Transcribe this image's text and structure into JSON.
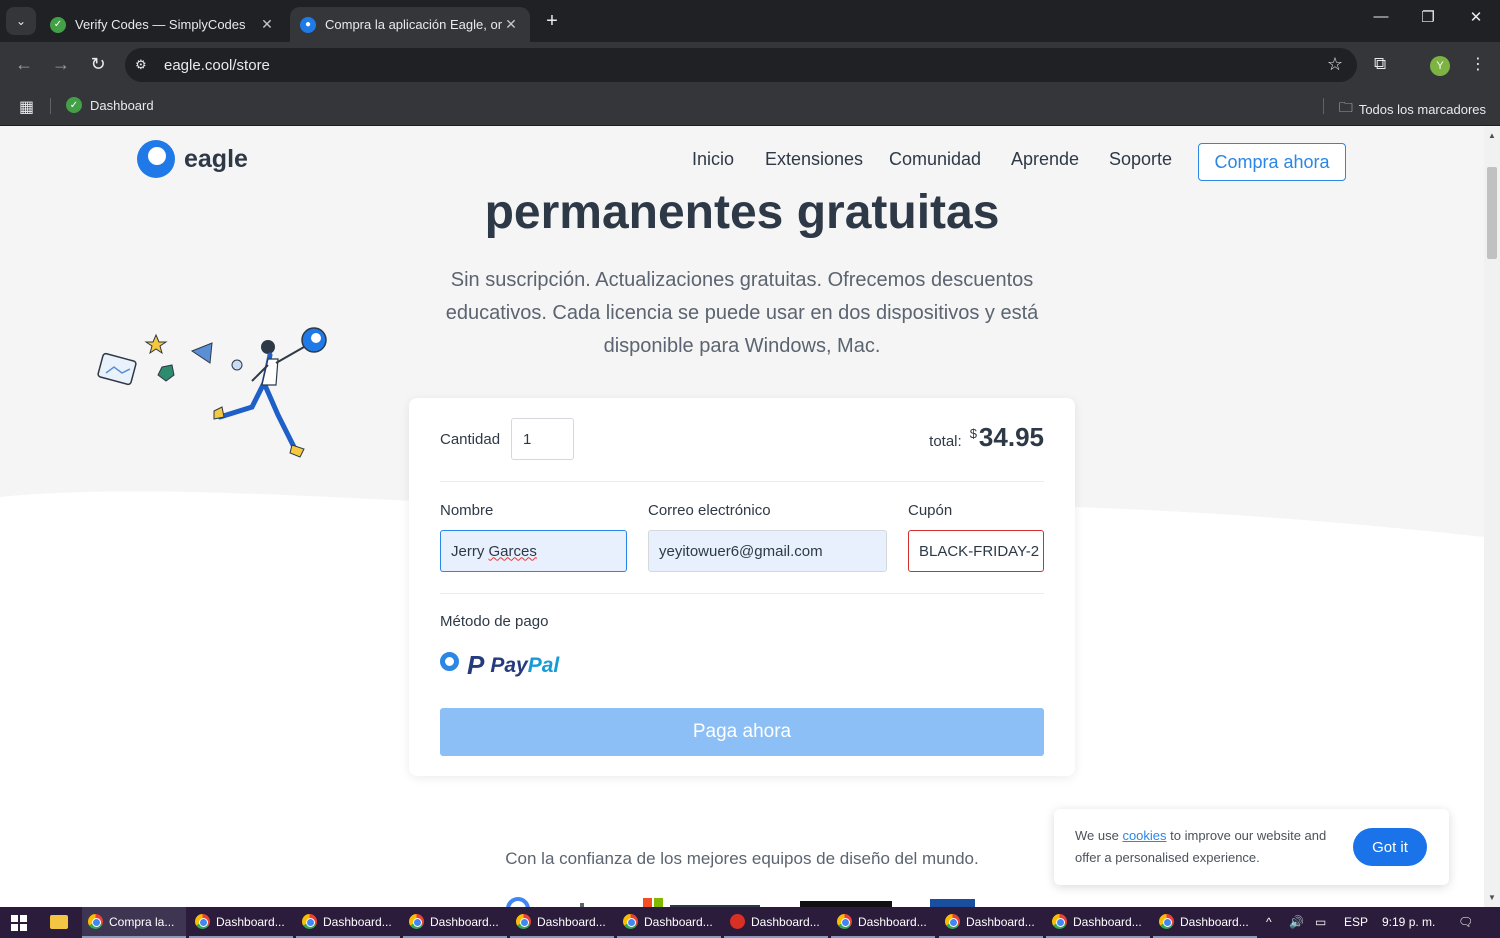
{
  "browser": {
    "tabs": [
      {
        "title": "Verify Codes — SimplyCodes",
        "active": false
      },
      {
        "title": "Compra la aplicación Eagle, org",
        "active": true
      }
    ],
    "url": "eagle.cool/store",
    "profile_initial": "Y",
    "bookmarks": [
      {
        "label": "Dashboard"
      }
    ],
    "all_bookmarks_label": "Todos los marcadores"
  },
  "site": {
    "logo_text": "eagle",
    "nav": [
      "Inicio",
      "Extensiones",
      "Comunidad",
      "Aprende",
      "Soporte"
    ],
    "cta": "Compra ahora"
  },
  "hero": {
    "headline": "permanentes gratuitas",
    "subtext": "Sin suscripción. Actualizaciones gratuitas. Ofrecemos descuentos educativos. Cada licencia se puede usar en dos dispositivos y está disponible para Windows, Mac."
  },
  "checkout": {
    "quantity_label": "Cantidad",
    "quantity_value": "1",
    "total_label": "total:",
    "currency": "$",
    "total_amount": "34.95",
    "name_label": "Nombre",
    "name_first": "Jerry ",
    "name_last": "Garces",
    "email_label": "Correo electrónico",
    "email_value": "yeyitowuer6@gmail.com",
    "coupon_label": "Cupón",
    "coupon_value": "BLACK-FRIDAY-2",
    "payment_label": "Método de pago",
    "paypal_pay": "Pay",
    "paypal_pal": "Pal",
    "pay_button": "Paga ahora"
  },
  "trust_text": "Con la confianza de los mejores equipos de diseño del mundo.",
  "cookie": {
    "prefix": "We use ",
    "link": "cookies",
    "suffix": " to improve our website and offer a personalised experience.",
    "button": "Got it"
  },
  "taskbar": {
    "items": [
      "Compra la...",
      "Dashboard...",
      "Dashboard...",
      "Dashboard...",
      "Dashboard...",
      "Dashboard...",
      "Dashboard...",
      "Dashboard...",
      "Dashboard...",
      "Dashboard...",
      "Dashboard..."
    ],
    "language": "ESP",
    "time": "9:19 p. m."
  },
  "colors": {
    "accent": "#2b86e6",
    "heading": "#2e3947",
    "pay_button": "#8cbff5",
    "coupon_error_border": "#d32f2f"
  }
}
